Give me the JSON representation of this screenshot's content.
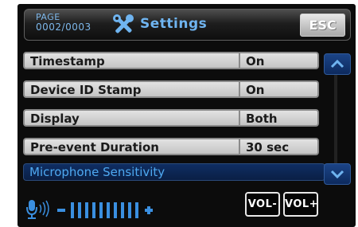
{
  "header": {
    "page_label": "PAGE",
    "page_number": "0002/0003",
    "title": "Settings",
    "esc_label": "ESC",
    "icon": "tools-icon"
  },
  "settings": [
    {
      "label": "Timestamp",
      "value": "On"
    },
    {
      "label": "Device ID Stamp",
      "value": "On"
    },
    {
      "label": "Display",
      "value": "Both"
    },
    {
      "label": "Pre-event Duration",
      "value": "30 sec"
    }
  ],
  "selected_item": {
    "label": "Microphone Sensitivity"
  },
  "scroll": {
    "up_icon": "chevron-up-icon",
    "down_icon": "chevron-down-icon"
  },
  "volume": {
    "mic_icon": "microphone-icon",
    "level_fraction": 1.0,
    "vol_down_label": "VOL-",
    "vol_up_label": "VOL+"
  },
  "colors": {
    "accent_blue": "#4ea8f0",
    "row_grey": "#d0d0d0",
    "selected_row": "#0f2e63"
  }
}
